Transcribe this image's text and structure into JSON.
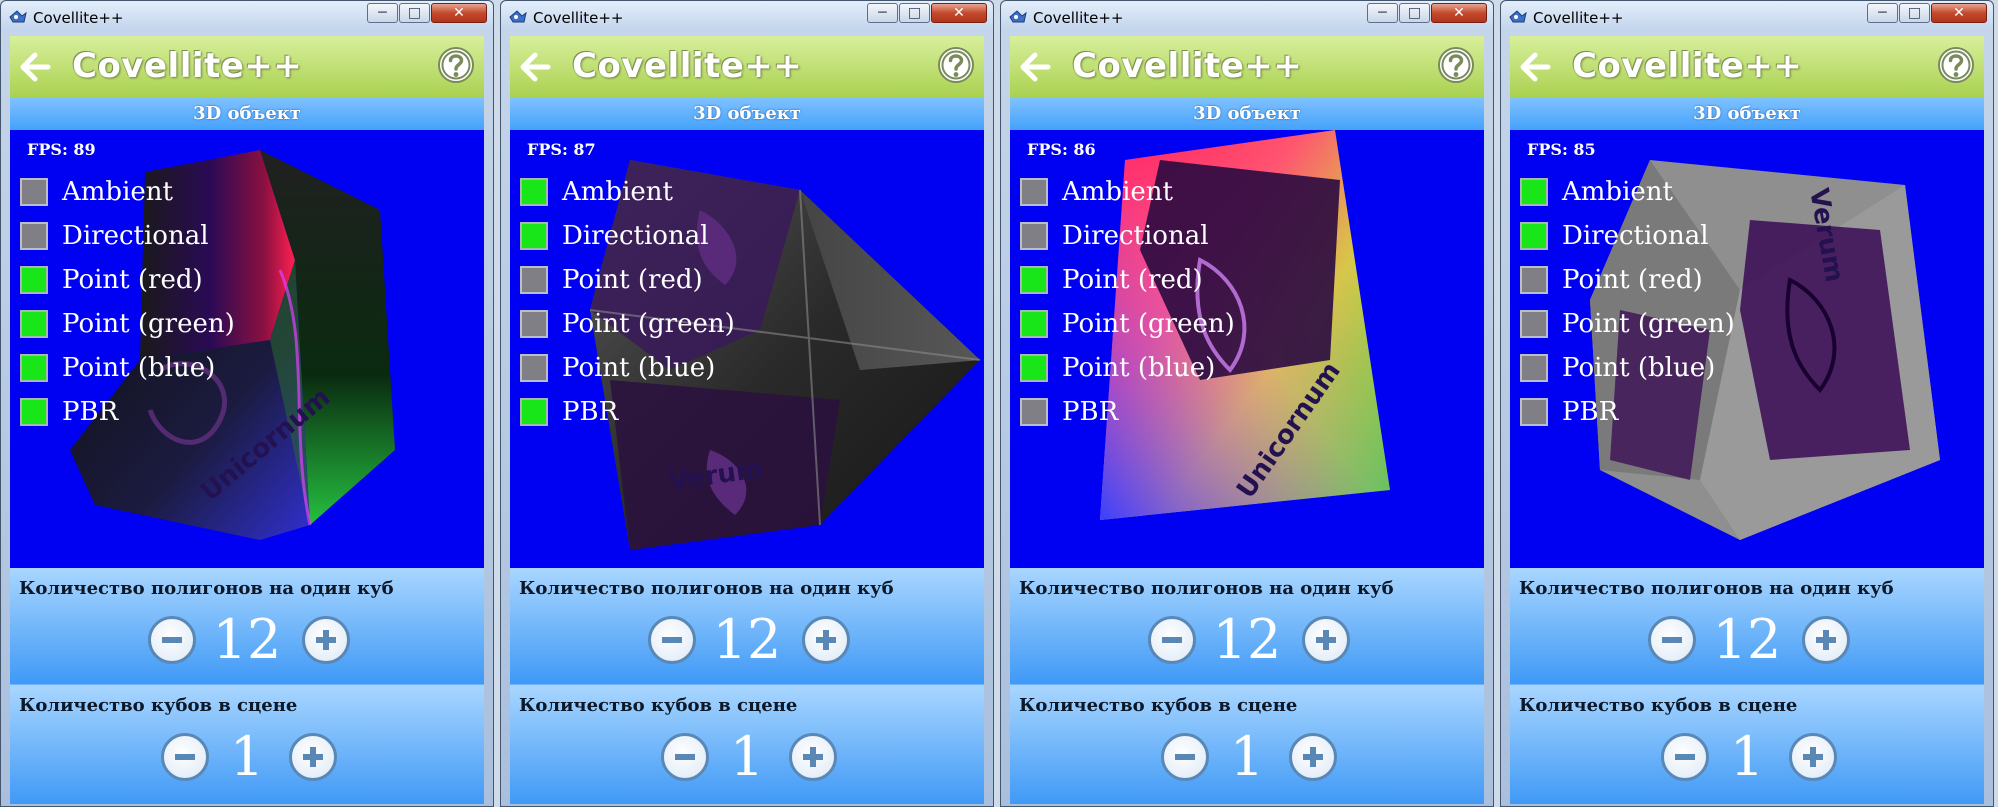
{
  "windows": [
    {
      "window_title": "Covellite++",
      "app_title": "Covellite++",
      "subheader": "3D объект",
      "fps": "FPS: 89",
      "lights": [
        {
          "label": "Ambient",
          "on": false
        },
        {
          "label": "Directional",
          "on": false
        },
        {
          "label": "Point (red)",
          "on": true
        },
        {
          "label": "Point (green)",
          "on": true
        },
        {
          "label": "Point (blue)",
          "on": true
        },
        {
          "label": "PBR",
          "on": true
        }
      ],
      "polygons_label": "Количество полигонов на один куб",
      "polygons_value": "12",
      "cubes_label": "Количество кубов в сцене",
      "cubes_value": "1",
      "cube_text": "Unicornum"
    },
    {
      "window_title": "Covellite++",
      "app_title": "Covellite++",
      "subheader": "3D объект",
      "fps": "FPS: 87",
      "lights": [
        {
          "label": "Ambient",
          "on": true
        },
        {
          "label": "Directional",
          "on": true
        },
        {
          "label": "Point (red)",
          "on": false
        },
        {
          "label": "Point (green)",
          "on": false
        },
        {
          "label": "Point (blue)",
          "on": false
        },
        {
          "label": "PBR",
          "on": true
        }
      ],
      "polygons_label": "Количество полигонов на один куб",
      "polygons_value": "12",
      "cubes_label": "Количество кубов в сцене",
      "cubes_value": "1",
      "cube_text": "Verum"
    },
    {
      "window_title": "Covellite++",
      "app_title": "Covellite++",
      "subheader": "3D объект",
      "fps": "FPS: 86",
      "lights": [
        {
          "label": "Ambient",
          "on": false
        },
        {
          "label": "Directional",
          "on": false
        },
        {
          "label": "Point (red)",
          "on": true
        },
        {
          "label": "Point (green)",
          "on": true
        },
        {
          "label": "Point (blue)",
          "on": true
        },
        {
          "label": "PBR",
          "on": false
        }
      ],
      "polygons_label": "Количество полигонов на один куб",
      "polygons_value": "12",
      "cubes_label": "Количество кубов в сцене",
      "cubes_value": "1",
      "cube_text": "Unicornum"
    },
    {
      "window_title": "Covellite++",
      "app_title": "Covellite++",
      "subheader": "3D объект",
      "fps": "FPS: 85",
      "lights": [
        {
          "label": "Ambient",
          "on": true
        },
        {
          "label": "Directional",
          "on": true
        },
        {
          "label": "Point (red)",
          "on": false
        },
        {
          "label": "Point (green)",
          "on": false
        },
        {
          "label": "Point (blue)",
          "on": false
        },
        {
          "label": "PBR",
          "on": false
        }
      ],
      "polygons_label": "Количество полигонов на один куб",
      "polygons_value": "12",
      "cubes_label": "Количество кубов в сцене",
      "cubes_value": "1",
      "cube_text": "Verum"
    }
  ],
  "icons": {
    "app": "covellite-app-icon",
    "back": "arrow-left-icon",
    "help": "question-mark-icon",
    "minus": "minus-icon",
    "plus": "plus-icon"
  },
  "colors": {
    "scene_background": "#0000f2",
    "checkbox_on": "#19e619",
    "checkbox_off": "#7f7f85",
    "appbar": "#a9d14f",
    "subheader": "#45a2fb"
  }
}
